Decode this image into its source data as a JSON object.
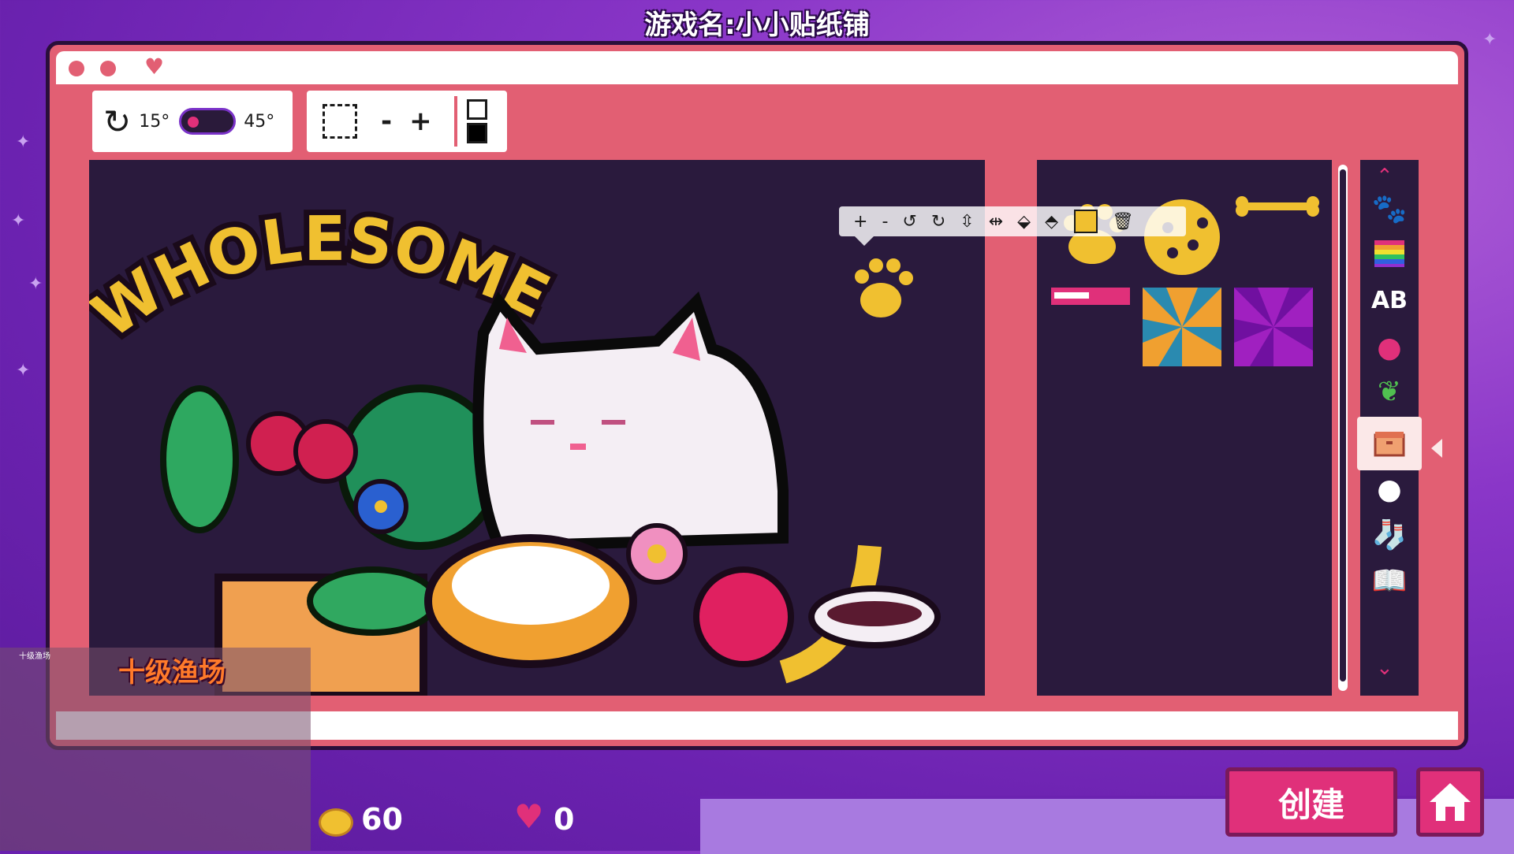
{
  "game_title": "游戏名:小小贴纸铺",
  "rotation": {
    "angle_small": "15°",
    "angle_large": "45°",
    "toggle_value": "15°"
  },
  "size_controls": {
    "minus": "-",
    "plus": "+"
  },
  "canvas": {
    "sign_text": "WHOLESOME"
  },
  "sticker_toolbar": {
    "add": "+",
    "remove": "-",
    "color": "#f0c030"
  },
  "hud": {
    "coins": "60",
    "hearts": "0",
    "create_button": "创建"
  },
  "overlay": {
    "label": "十级渔场",
    "header_text": "十级渔场"
  },
  "colors": {
    "window": "#e25f73",
    "canvas_bg": "#2a1a3d",
    "accent_pink": "#e0307a",
    "coin_gold": "#f0c030",
    "background": "#7a2cbc"
  },
  "category_icons": [
    "paw-icon",
    "rainbow-icon",
    "text-icon",
    "apple-icon",
    "leaf-icon",
    "box-icon",
    "circle-icon",
    "sock-icon",
    "book-icon"
  ]
}
